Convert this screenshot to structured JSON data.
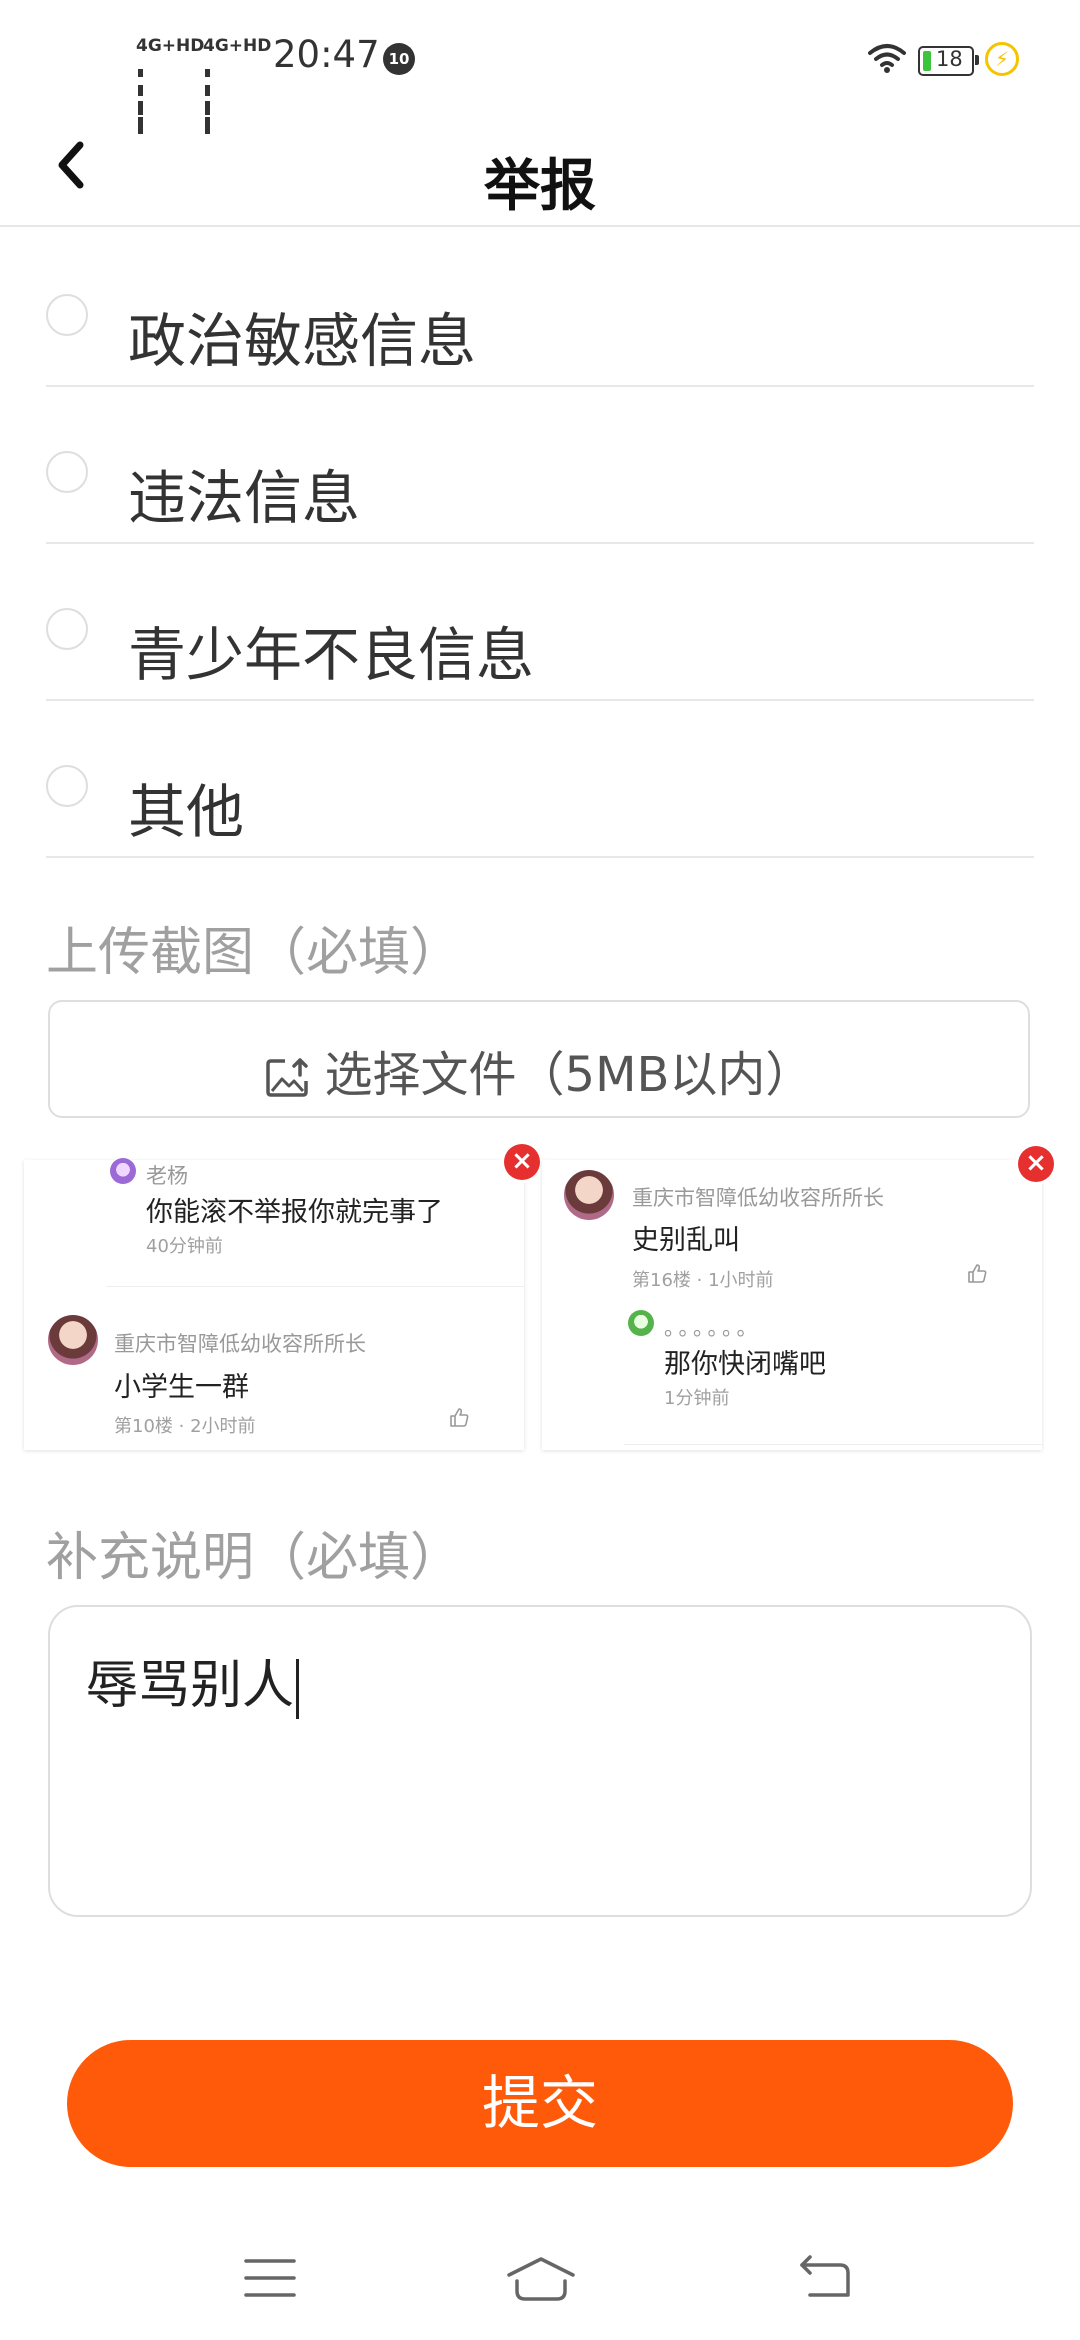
{
  "status_bar": {
    "signal1": "4G+HD",
    "signal2": "4G+HD",
    "time": "20:47",
    "notification_count": "10",
    "battery": "18",
    "battery_color": "#3cc53c"
  },
  "header": {
    "title": "举报"
  },
  "options": [
    {
      "label": "政治敏感信息",
      "selected": false
    },
    {
      "label": "违法信息",
      "selected": false
    },
    {
      "label": "青少年不良信息",
      "selected": false
    },
    {
      "label": "其他",
      "selected": false
    }
  ],
  "upload": {
    "title": "上传截图（必填）",
    "button_label": "选择文件（5MB以内）"
  },
  "screenshots": [
    {
      "comments": [
        {
          "name": "老杨",
          "text": "你能滚不举报你就完事了",
          "meta": "40分钟前"
        },
        {
          "name": "重庆市智障低幼收容所所长",
          "text": "小学生一群",
          "meta": "第10楼 · 2小时前"
        }
      ]
    },
    {
      "comments": [
        {
          "name": "重庆市智障低幼收容所所长",
          "text": "史别乱叫",
          "meta": "第16楼 · 1小时前"
        },
        {
          "name": "。。。。。。",
          "text": "那你快闭嘴吧",
          "meta": "1分钟前"
        }
      ]
    }
  ],
  "supplement": {
    "title": "补充说明（必填）",
    "value": "辱骂别人"
  },
  "submit_label": "提交",
  "accent_color": "#ff5a0a"
}
